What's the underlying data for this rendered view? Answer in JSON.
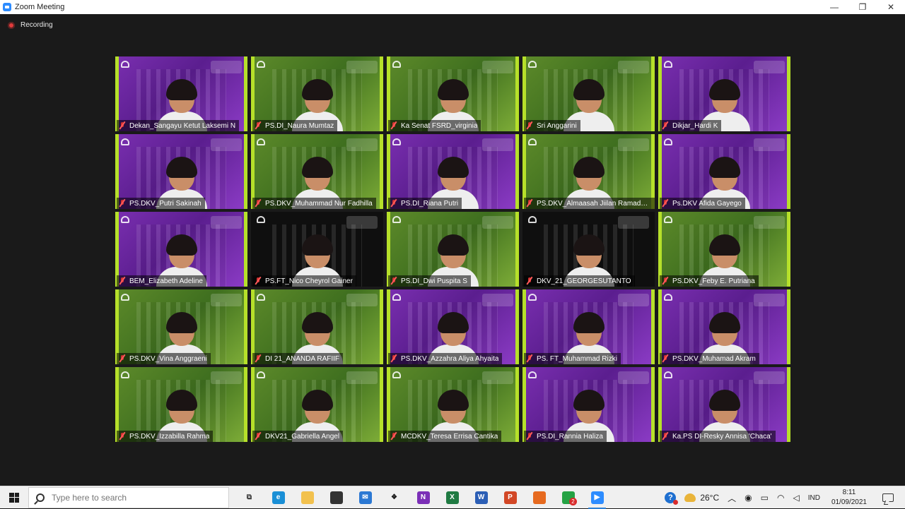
{
  "window": {
    "title": "Zoom Meeting",
    "controls": {
      "minimize": "—",
      "maximize": "❐",
      "close": "✕"
    }
  },
  "meeting": {
    "recording_label": "Recording",
    "participants": [
      {
        "name": "Dekan_Sangayu Ketut Laksemi N",
        "bg": "purple",
        "muted": true
      },
      {
        "name": "PS.DI_Naura Mumtaz",
        "bg": "green",
        "muted": true
      },
      {
        "name": "Ka Senat FSRD_virginia",
        "bg": "green",
        "muted": true
      },
      {
        "name": "Sri Anggarini",
        "bg": "green",
        "muted": true
      },
      {
        "name": "Dikjar_Hardi K",
        "bg": "purple",
        "muted": true
      },
      {
        "name": "PS.DKV_Putri Sakinah",
        "bg": "purple",
        "muted": true
      },
      {
        "name": "PS.DKV_Muhammad Nur Fadhilla",
        "bg": "green",
        "muted": true
      },
      {
        "name": "PS.DI_Riana Putri",
        "bg": "purple",
        "muted": true
      },
      {
        "name": "PS.DKV_Almaasah Jiilan Ramadhan",
        "bg": "green",
        "muted": true
      },
      {
        "name": "Ps.DKV Afida Gayego",
        "bg": "purple",
        "muted": true
      },
      {
        "name": "BEM_Elizabeth Adeline",
        "bg": "purple",
        "muted": true
      },
      {
        "name": "PS.FT_Nico Cheyrol Gainer",
        "bg": "dark",
        "muted": true
      },
      {
        "name": "PS.DI_Dwi Puspita S",
        "bg": "green",
        "muted": true
      },
      {
        "name": "DKV_21_GEORGESUTANTO",
        "bg": "dark",
        "muted": true
      },
      {
        "name": "PS.DKV_Feby E. Putriana",
        "bg": "green",
        "muted": true
      },
      {
        "name": "PS.DKV_Vina Anggraeni",
        "bg": "green",
        "muted": true
      },
      {
        "name": "DI 21_ANANDA RAFIIF",
        "bg": "green",
        "muted": true
      },
      {
        "name": "PS.DKV_Azzahra Aliya Ahyaita",
        "bg": "purple",
        "muted": true
      },
      {
        "name": "PS. FT_Muhammad Rizki",
        "bg": "purple",
        "muted": true
      },
      {
        "name": "PS.DKV_Muhamad Akram",
        "bg": "purple",
        "muted": true
      },
      {
        "name": "PS.DKV_Izzabilla Rahma",
        "bg": "green",
        "muted": true
      },
      {
        "name": "DKV21_Gabriella Angel",
        "bg": "green",
        "muted": true
      },
      {
        "name": "MCDKV_Teresa Errisa Cantika",
        "bg": "green",
        "muted": true
      },
      {
        "name": "PS.DI_Rannia Haliza",
        "bg": "purple",
        "muted": true
      },
      {
        "name": "Ka.PS DI-Resky Annisa 'Chaca'",
        "bg": "purple",
        "muted": true
      }
    ]
  },
  "taskbar": {
    "search_placeholder": "Type here to search",
    "apps": [
      {
        "icon": "task-view-icon",
        "glyph": "⧉",
        "color": "#f0f0f0",
        "text_color": "#333"
      },
      {
        "icon": "edge-icon",
        "glyph": "e",
        "color": "#1a8fd6",
        "text_color": "#fff"
      },
      {
        "icon": "file-explorer-icon",
        "glyph": "",
        "color": "#f2c14e",
        "text_color": "#fff"
      },
      {
        "icon": "store-icon",
        "glyph": "",
        "color": "#333333",
        "text_color": "#fff"
      },
      {
        "icon": "mail-icon",
        "glyph": "✉",
        "color": "#2b78d3",
        "text_color": "#fff"
      },
      {
        "icon": "dropbox-icon",
        "glyph": "❖",
        "color": "#f0f0f0",
        "text_color": "#1b1b1b"
      },
      {
        "icon": "onenote-icon",
        "glyph": "N",
        "color": "#7b2fb7",
        "text_color": "#fff"
      },
      {
        "icon": "excel-icon",
        "glyph": "X",
        "color": "#1f7a42",
        "text_color": "#fff"
      },
      {
        "icon": "word-icon",
        "glyph": "W",
        "color": "#2b5eb5",
        "text_color": "#fff"
      },
      {
        "icon": "powerpoint-icon",
        "glyph": "P",
        "color": "#d24726",
        "text_color": "#fff"
      },
      {
        "icon": "firefox-icon",
        "glyph": "",
        "color": "#e66a1f",
        "text_color": "#fff"
      },
      {
        "icon": "whatsapp-icon",
        "glyph": "",
        "color": "#25a244",
        "text_color": "#fff",
        "badge": "2"
      },
      {
        "icon": "zoom-icon",
        "glyph": "▶",
        "color": "#2d8cff",
        "text_color": "#fff",
        "active": true
      }
    ],
    "tray": {
      "temperature": "26°C",
      "language": "IND",
      "time": "8:11",
      "date": "01/09/2021"
    }
  }
}
